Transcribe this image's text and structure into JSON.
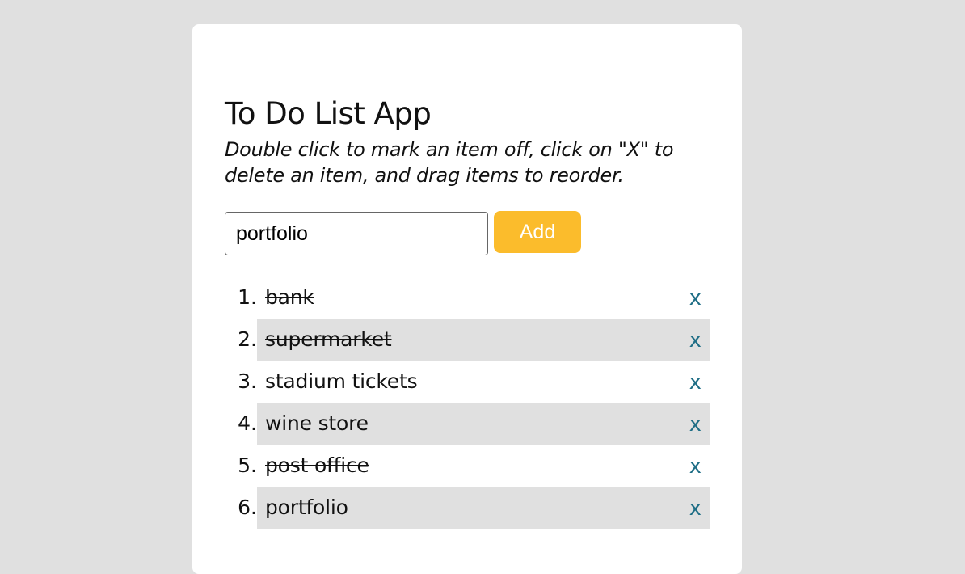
{
  "app": {
    "title": "To Do List App",
    "instructions": "Double click to mark an item off, click on \"X\" to delete an item, and drag items to reorder."
  },
  "form": {
    "input_value": "portfolio",
    "add_label": "Add"
  },
  "todos": [
    {
      "number": "1.",
      "text": "bank",
      "done": true,
      "delete_label": "x"
    },
    {
      "number": "2.",
      "text": "supermarket",
      "done": true,
      "delete_label": "x"
    },
    {
      "number": "3.",
      "text": "stadium tickets",
      "done": false,
      "delete_label": "x"
    },
    {
      "number": "4.",
      "text": "wine store",
      "done": false,
      "delete_label": "x"
    },
    {
      "number": "5.",
      "text": "post office",
      "done": true,
      "delete_label": "x"
    },
    {
      "number": "6.",
      "text": "portfolio",
      "done": false,
      "delete_label": "x"
    }
  ],
  "colors": {
    "page_background": "#e0e0e0",
    "card_background": "#ffffff",
    "button_background": "#fbbc2c",
    "delete_color": "#1f6e86",
    "row_shade": "#e0e0e0"
  }
}
